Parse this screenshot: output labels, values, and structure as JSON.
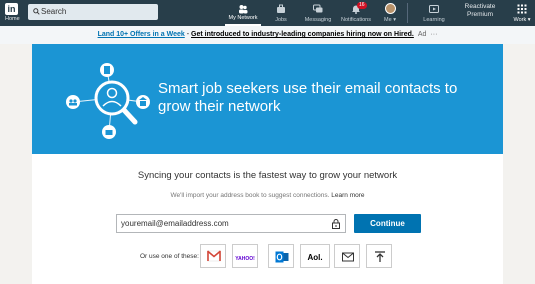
{
  "nav": {
    "logo": "in",
    "home": "Home",
    "search_placeholder": "Search",
    "items": [
      {
        "label": "My Network",
        "icon": "people-icon"
      },
      {
        "label": "Jobs",
        "icon": "briefcase-icon"
      },
      {
        "label": "Messaging",
        "icon": "chat-icon"
      },
      {
        "label": "Notifications",
        "icon": "bell-icon",
        "badge": "16"
      },
      {
        "label": "Me ▾",
        "icon": "avatar"
      },
      {
        "label": "Learning",
        "icon": "play-icon"
      },
      {
        "label": "Work ▾",
        "icon": "grid-icon"
      }
    ],
    "reactivate": "Reactivate Premium"
  },
  "ad": {
    "link": "Land 10+ Offers in a Week",
    "sep": " - ",
    "rest": "Get introduced to industry-leading companies hiring now on Hired.",
    "tag": "Ad",
    "more": "···"
  },
  "hero": {
    "text": "Smart job seekers use their email contacts to grow their network"
  },
  "sync": {
    "title": "Syncing your contacts is the fastest way to grow your network",
    "note": "We'll import your address book to suggest connections.",
    "learn_more": "Learn more",
    "email_value": "youremail@emailaddress.com",
    "continue": "Continue",
    "or_use": "Or use one of these:",
    "providers": [
      {
        "name": "gmail",
        "label": "M"
      },
      {
        "name": "yahoo",
        "label": "YAHOO!"
      },
      {
        "name": "outlook",
        "label": "O"
      },
      {
        "name": "aol",
        "label": "Aol."
      },
      {
        "name": "email",
        "label": ""
      },
      {
        "name": "upload",
        "label": ""
      }
    ]
  },
  "colors": {
    "nav_bg": "#283e4a",
    "hero_bg": "#1b95d4",
    "primary": "#0073b1"
  }
}
